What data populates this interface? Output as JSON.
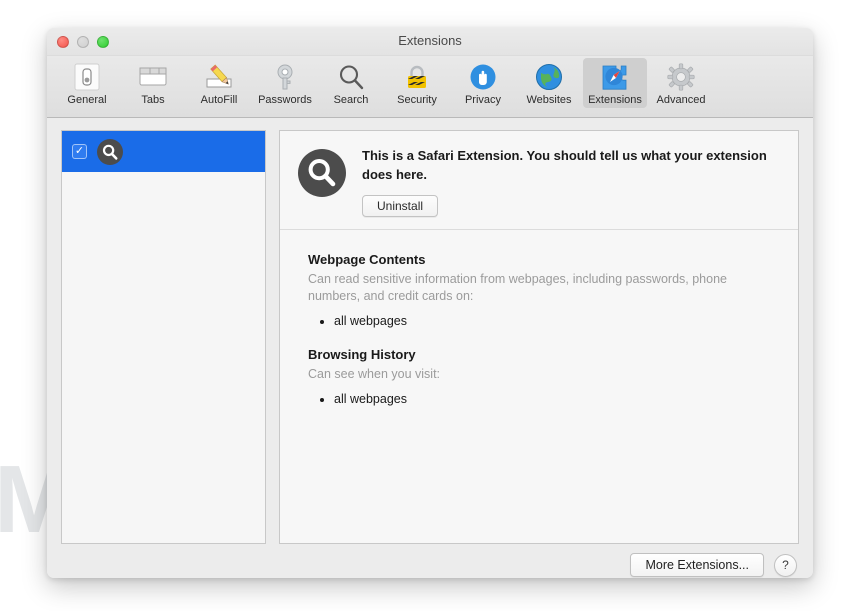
{
  "window": {
    "title": "Extensions",
    "traffic_lights": [
      {
        "name": "close",
        "color": "#f3534a"
      },
      {
        "name": "minimize",
        "color": "#cfcfcf"
      },
      {
        "name": "zoom",
        "color": "#2ecd2e"
      }
    ]
  },
  "toolbar": {
    "items": [
      {
        "label": "General",
        "icon": "general-icon",
        "selected": false
      },
      {
        "label": "Tabs",
        "icon": "tabs-icon",
        "selected": false
      },
      {
        "label": "AutoFill",
        "icon": "autofill-icon",
        "selected": false
      },
      {
        "label": "Passwords",
        "icon": "passwords-icon",
        "selected": false
      },
      {
        "label": "Search",
        "icon": "search-icon",
        "selected": false
      },
      {
        "label": "Security",
        "icon": "security-icon",
        "selected": false
      },
      {
        "label": "Privacy",
        "icon": "privacy-icon",
        "selected": false
      },
      {
        "label": "Websites",
        "icon": "websites-icon",
        "selected": false
      },
      {
        "label": "Extensions",
        "icon": "extensions-icon",
        "selected": true
      },
      {
        "label": "Advanced",
        "icon": "advanced-icon",
        "selected": false
      }
    ]
  },
  "sidebar": {
    "rows": [
      {
        "label": "",
        "icon": "magnifier-icon",
        "checked": true,
        "checkmark": "✓",
        "selected": true,
        "selected_color": "#1a6ce8"
      }
    ]
  },
  "detail": {
    "icon": "magnifier-icon",
    "description": "This is a Safari Extension. You should tell us what your extension does here.",
    "uninstall_label": "Uninstall",
    "permissions": [
      {
        "title": "Webpage Contents",
        "description": "Can read sensitive information from webpages, including passwords, phone numbers, and credit cards on:",
        "items": [
          "all webpages"
        ]
      },
      {
        "title": "Browsing History",
        "description": "Can see when you visit:",
        "items": [
          "all webpages"
        ]
      }
    ]
  },
  "bottom_bar": {
    "more_extensions_label": "More Extensions...",
    "help_label": "?"
  },
  "watermark": {
    "text": "MALWARETIPS",
    "logo": "chevron-shield-logo",
    "color": "#e4e6e8"
  }
}
